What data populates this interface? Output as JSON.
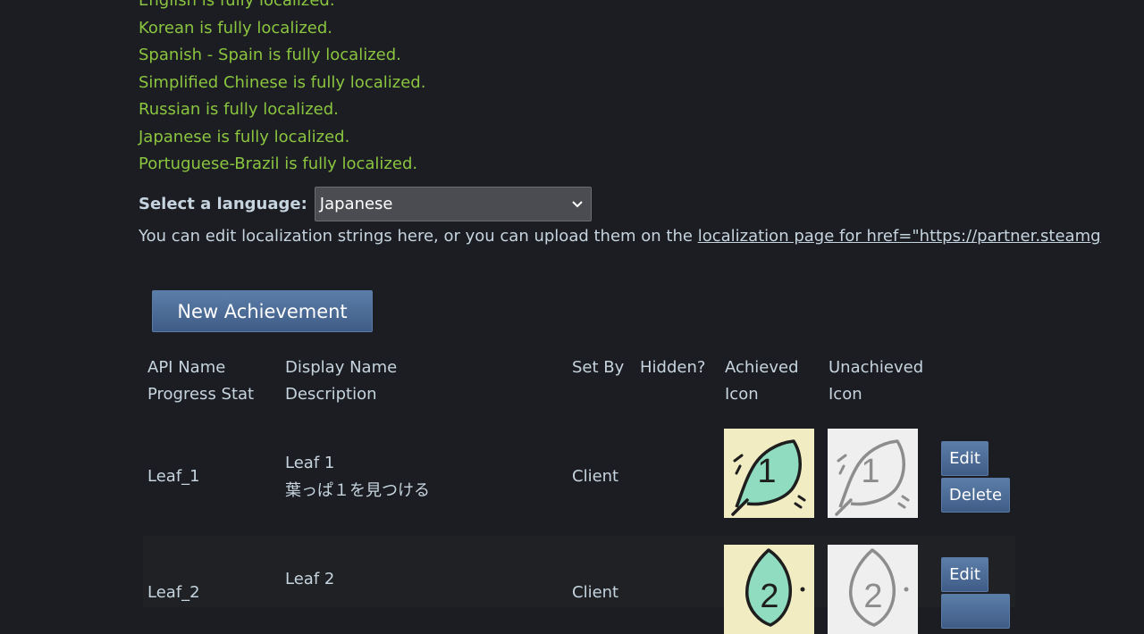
{
  "localization": {
    "status_lines": [
      "English is fully localized.",
      "Korean is fully localized.",
      "Spanish - Spain is fully localized.",
      "Simplified Chinese is fully localized.",
      "Russian is fully localized.",
      "Japanese is fully localized.",
      "Portuguese-Brazil is fully localized."
    ],
    "language_label": "Select a language:",
    "selected_language": "Japanese",
    "info_text": "You can edit localization strings here, or you can upload them on the ",
    "info_link": "localization page for href=\"https://partner.steamg"
  },
  "toolbar": {
    "new_achievement_label": "New Achievement"
  },
  "table": {
    "headers": {
      "api_name": "API Name",
      "progress_stat": "Progress Stat",
      "display_name": "Display Name",
      "description": "Description",
      "set_by": "Set By",
      "hidden": "Hidden?",
      "achieved_icon_1": "Achieved",
      "achieved_icon_2": "Icon",
      "unachieved_icon_1": "Unachieved",
      "unachieved_icon_2": "Icon"
    },
    "rows": [
      {
        "api_name": "Leaf_1",
        "display_name": "Leaf 1",
        "description": "葉っぱ１を見つける",
        "set_by": "Client",
        "icon_number": "1",
        "edit_label": "Edit",
        "delete_label": "Delete"
      },
      {
        "api_name": "Leaf_2",
        "display_name": "Leaf 2",
        "set_by": "Client",
        "icon_number": "2",
        "edit_label": "Edit"
      }
    ]
  },
  "colors": {
    "background": "#1b1d22",
    "success_text": "#8bc53f",
    "body_text": "#c6d4df",
    "button_blue": "#4a6a95",
    "achieved_icon_bg": "#f2ecc3",
    "achieved_leaf_fill": "#8fdcc0",
    "unachieved_icon_bg": "#efefef"
  }
}
